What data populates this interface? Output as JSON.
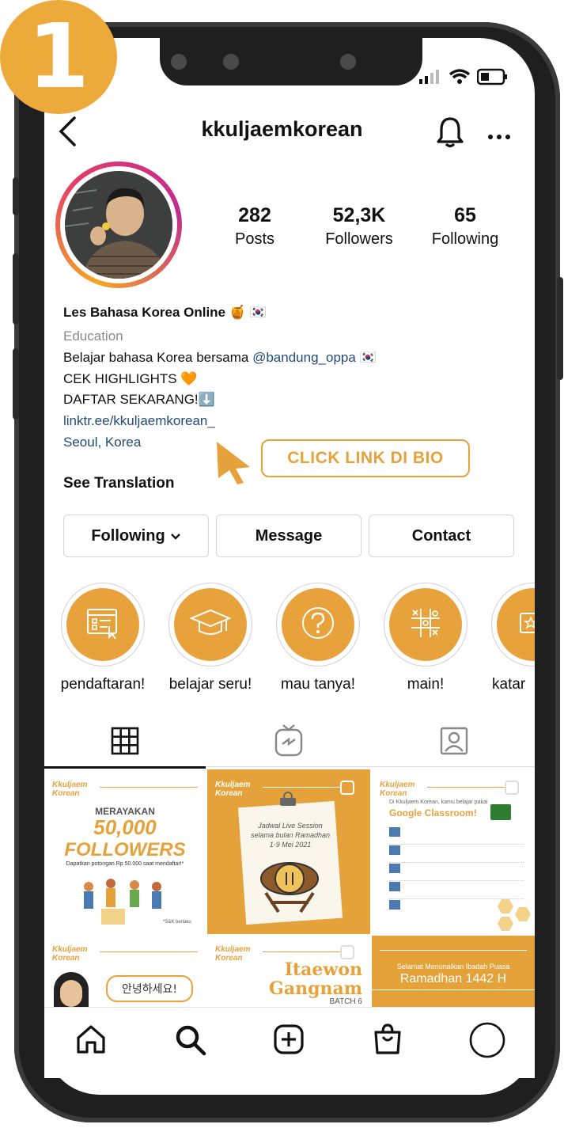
{
  "step": {
    "number": "1",
    "color": "#ecaa3b"
  },
  "status_bar": {
    "icons": [
      "signal-icon",
      "wifi-icon",
      "battery-icon"
    ]
  },
  "header": {
    "title": "kkuljaemkorean",
    "icons": [
      "back-icon",
      "bell-icon",
      "more-icon"
    ]
  },
  "profile": {
    "stats": [
      {
        "value": "282",
        "label": "Posts"
      },
      {
        "value": "52,3K",
        "label": "Followers"
      },
      {
        "value": "65",
        "label": "Following"
      }
    ],
    "name": "Les Bahasa Korea Online 🍯 🇰🇷",
    "category": "Education",
    "bio_line1_prefix": "Belajar bahasa Korea bersama ",
    "bio_line1_mention": "@bandung_oppa",
    "bio_line1_suffix": " 🇰🇷",
    "bio_line2": "CEK HIGHLIGHTS 🧡",
    "bio_line3": "DAFTAR SEKARANG!⬇️",
    "link": "linktr.ee/kkuljaemkorean_",
    "location": "Seoul, Korea",
    "see_translation": "See Translation"
  },
  "callout": {
    "label": "CLICK LINK DI BIO",
    "accent": "#e6a23a"
  },
  "actions": {
    "following": "Following",
    "message": "Message",
    "contact": "Contact"
  },
  "highlights": [
    {
      "label": "pendaftaran!",
      "icon": "form-icon"
    },
    {
      "label": "belajar seru!",
      "icon": "graduation-cap-icon"
    },
    {
      "label": "mau tanya!",
      "icon": "question-icon"
    },
    {
      "label": "main!",
      "icon": "tic-tac-toe-icon"
    },
    {
      "label": "katar",
      "icon": "star-card-icon"
    }
  ],
  "tabs": [
    {
      "name": "grid",
      "icon": "grid-icon"
    },
    {
      "name": "igtv",
      "icon": "igtv-icon"
    },
    {
      "name": "tagged",
      "icon": "tagged-icon"
    }
  ],
  "posts": {
    "p1": {
      "brand": "Kkuljaem Korean",
      "line1": "MERAYAKAN",
      "line2": "50,000",
      "line3": "FOLLOWERS",
      "line4": "Dapatkan potongan Rp 50.000 saat mendaftar!*",
      "line5": "*S&K berlaku"
    },
    "p2": {
      "brand": "Kkuljaem Korean",
      "line1": "Jadwal Live Session",
      "line2": "selama bulan Ramadhan",
      "line3": "1-9 Mei 2021"
    },
    "p3": {
      "brand": "Kkuljaem Korean",
      "line1": "Di Kkuljaem Korean, kamu belajar pakai",
      "line2": "Google Classroom!"
    },
    "p4": {
      "brand": "Kkuljaem Korean",
      "bubble": "안녕하세요!"
    },
    "p5": {
      "brand": "Kkuljaem Korean",
      "line1": "Itaewon",
      "line2": "Gangnam",
      "line3": "BATCH 6"
    },
    "p6": {
      "line1": "Selamat Menunaikan Ibadah Puasa",
      "line2": "Ramadhan 1442 H"
    }
  },
  "bottom_nav": [
    "home-icon",
    "search-icon",
    "new-post-icon",
    "shop-icon",
    "profile-icon"
  ],
  "colors": {
    "accent": "#e6a23a",
    "link": "#1f4b7a",
    "text": "#111111",
    "muted": "#8a8a8a"
  }
}
